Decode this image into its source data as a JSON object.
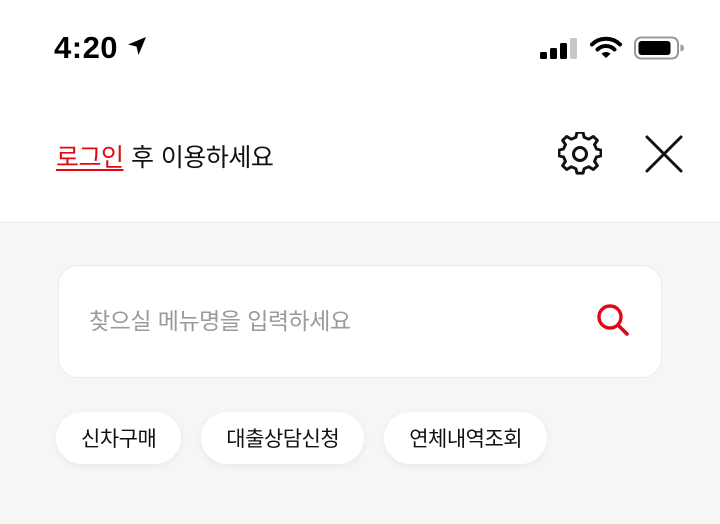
{
  "status_bar": {
    "time": "4:20",
    "icons": [
      "location-arrow-icon",
      "cellular-signal-icon",
      "wifi-icon",
      "battery-icon"
    ]
  },
  "header": {
    "login_link": "로그인",
    "login_suffix": " 후 이용하세요",
    "icons": [
      "gear-icon",
      "close-icon"
    ],
    "link_color": "#e30613"
  },
  "search": {
    "placeholder": "찾으실 메뉴명을 입력하세요",
    "value": "",
    "icon": "search-icon",
    "icon_color": "#e30613"
  },
  "quick_menu": [
    {
      "label": "신차구매"
    },
    {
      "label": "대출상담신청"
    },
    {
      "label": "연체내역조회"
    }
  ]
}
